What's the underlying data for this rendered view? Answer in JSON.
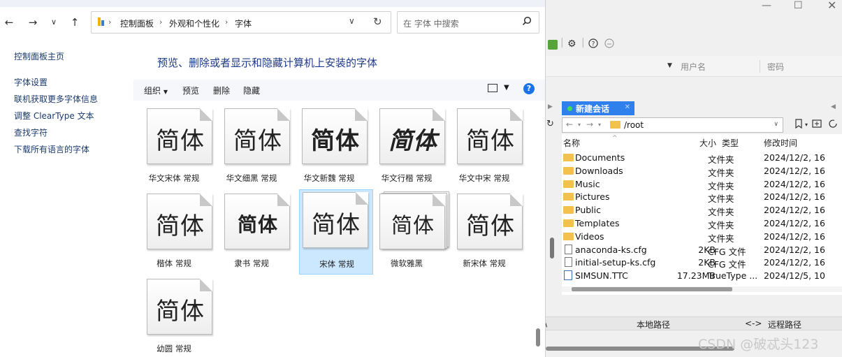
{
  "fonts_window": {
    "nav": {
      "back": "←",
      "forward": "→",
      "recent": "∨",
      "up": "↑"
    },
    "breadcrumb": [
      "控制面板",
      "外观和个性化",
      "字体"
    ],
    "search_placeholder": "在 字体 中搜索",
    "sidebar": {
      "home": "控制面板主页",
      "links": [
        "字体设置",
        "联机获取更多字体信息",
        "调整 ClearType 文本",
        "查找字符",
        "下载所有语言的字体"
      ]
    },
    "heading": "预览、删除或者显示和隐藏计算机上安装的字体",
    "toolbar": {
      "organize": "组织",
      "preview": "预览",
      "delete": "删除",
      "hide": "隐藏",
      "help": "?"
    },
    "fonts": [
      {
        "sample": "简体",
        "label": "华文宋体 常规"
      },
      {
        "sample": "简体",
        "label": "华文细黑 常规"
      },
      {
        "sample": "简体",
        "label": "华文新魏 常规"
      },
      {
        "sample": "简体",
        "label": "华文行楷 常规"
      },
      {
        "sample": "简体",
        "label": "华文中宋 常规"
      },
      {
        "sample": "简体",
        "label": "楷体 常规"
      },
      {
        "sample": "简体",
        "label": "隶书 常规"
      },
      {
        "sample": "简体",
        "label": "宋体 常规",
        "selected": true
      },
      {
        "sample": "简体",
        "label": "微软雅黑",
        "stacked": true
      },
      {
        "sample": "简体",
        "label": "新宋体 常规"
      },
      {
        "sample": "简体",
        "label": "幼圆 常规"
      }
    ]
  },
  "ftp_window": {
    "connection": {
      "user_placeholder": "用户名",
      "password_placeholder": "密码"
    },
    "tab": {
      "label": "新建会话"
    },
    "path": "/root",
    "columns": {
      "name": "名称",
      "size": "大小",
      "type": "类型",
      "mtime": "修改时间"
    },
    "rows": [
      {
        "kind": "folder",
        "name": "Documents",
        "size": "",
        "type": "文件夹",
        "mtime": "2024/12/2, 16"
      },
      {
        "kind": "folder",
        "name": "Downloads",
        "size": "",
        "type": "文件夹",
        "mtime": "2024/12/2, 16"
      },
      {
        "kind": "folder",
        "name": "Music",
        "size": "",
        "type": "文件夹",
        "mtime": "2024/12/2, 16"
      },
      {
        "kind": "folder",
        "name": "Pictures",
        "size": "",
        "type": "文件夹",
        "mtime": "2024/12/2, 16"
      },
      {
        "kind": "folder",
        "name": "Public",
        "size": "",
        "type": "文件夹",
        "mtime": "2024/12/2, 16"
      },
      {
        "kind": "folder",
        "name": "Templates",
        "size": "",
        "type": "文件夹",
        "mtime": "2024/12/2, 16"
      },
      {
        "kind": "folder",
        "name": "Videos",
        "size": "",
        "type": "文件夹",
        "mtime": "2024/12/2, 16"
      },
      {
        "kind": "file",
        "name": "anaconda-ks.cfg",
        "size": "2KB",
        "type": "CFG 文件",
        "mtime": "2024/12/2, 16"
      },
      {
        "kind": "file",
        "name": "initial-setup-ks.cfg",
        "size": "2KB",
        "type": "CFG 文件",
        "mtime": "2024/12/2, 16"
      },
      {
        "kind": "ttc",
        "name": "SIMSUN.TTC",
        "size": "17.23MB",
        "type": "TrueType ...",
        "mtime": "2024/12/5, 10"
      }
    ],
    "transfer_columns": {
      "local": "本地路径",
      "dir": "<->",
      "remote": "远程路径"
    }
  },
  "watermark": "CSDN @破忒头123",
  "colors": {
    "accent": "#1a73e8",
    "selection": "#cce8ff",
    "tab": "#2f80ed",
    "folder": "#f2c14e"
  }
}
